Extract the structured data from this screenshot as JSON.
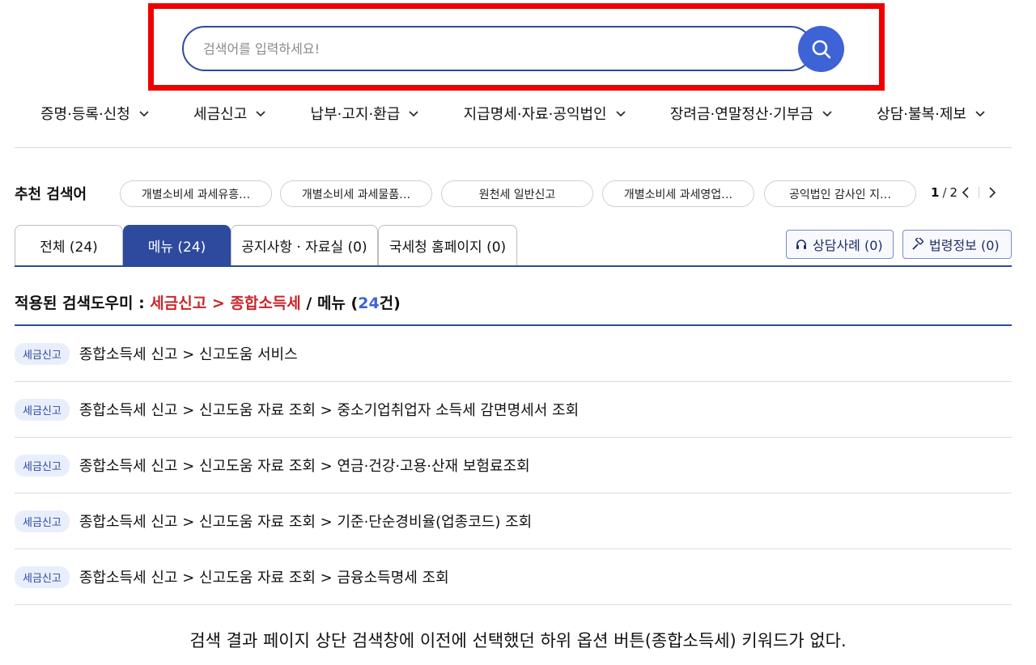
{
  "search": {
    "placeholder": "검색어를 입력하세요!",
    "value": ""
  },
  "highlight_color": "#ee0000",
  "accent_color": "#2e4a9e",
  "nav": [
    "증명·등록·신청",
    "세금신고",
    "납부·고지·환급",
    "지급명세·자료·공익법인",
    "장려금·연말정산·기부금",
    "상담·불복·제보"
  ],
  "recommended": {
    "label": "추천 검색어",
    "chips": [
      "개별소비세 과세유흥…",
      "개별소비세 과세물품…",
      "원천세 일반신고",
      "개별소비세 과세영업…",
      "공익법인 감사인 지…"
    ],
    "page_current": "1",
    "page_total": "2"
  },
  "tabs": [
    {
      "label": "전체 (24)",
      "active": false
    },
    {
      "label": "메뉴 (24)",
      "active": true
    },
    {
      "label": "공지사항 · 자료실 (0)",
      "active": false
    },
    {
      "label": "국세청 홈페이지 (0)",
      "active": false
    }
  ],
  "side_buttons": {
    "consult": "상담사례 (0)",
    "law": "법령정보 (0)"
  },
  "filter": {
    "prefix": "적용된 검색도우미 : ",
    "path": "세금신고 > 종합소득세",
    "mid": " / 메뉴 (",
    "count": "24",
    "suffix": "건)"
  },
  "results": [
    {
      "tag": "세금신고",
      "text": "종합소득세 신고 > 신고도움 서비스"
    },
    {
      "tag": "세금신고",
      "text": "종합소득세 신고 > 신고도움 자료 조회 > 중소기업취업자 소득세 감면명세서 조회"
    },
    {
      "tag": "세금신고",
      "text": "종합소득세 신고 > 신고도움 자료 조회 > 연금·건강·고용·산재 보험료조회"
    },
    {
      "tag": "세금신고",
      "text": "종합소득세 신고 > 신고도움 자료 조회 > 기준·단순경비율(업종코드) 조회"
    },
    {
      "tag": "세금신고",
      "text": "종합소득세 신고 > 신고도움 자료 조회 > 금융소득명세 조회"
    }
  ],
  "caption": "검색 결과 페이지 상단 검색창에 이전에 선택했던 하위 옵션 버튼(종합소득세) 키워드가 없다."
}
